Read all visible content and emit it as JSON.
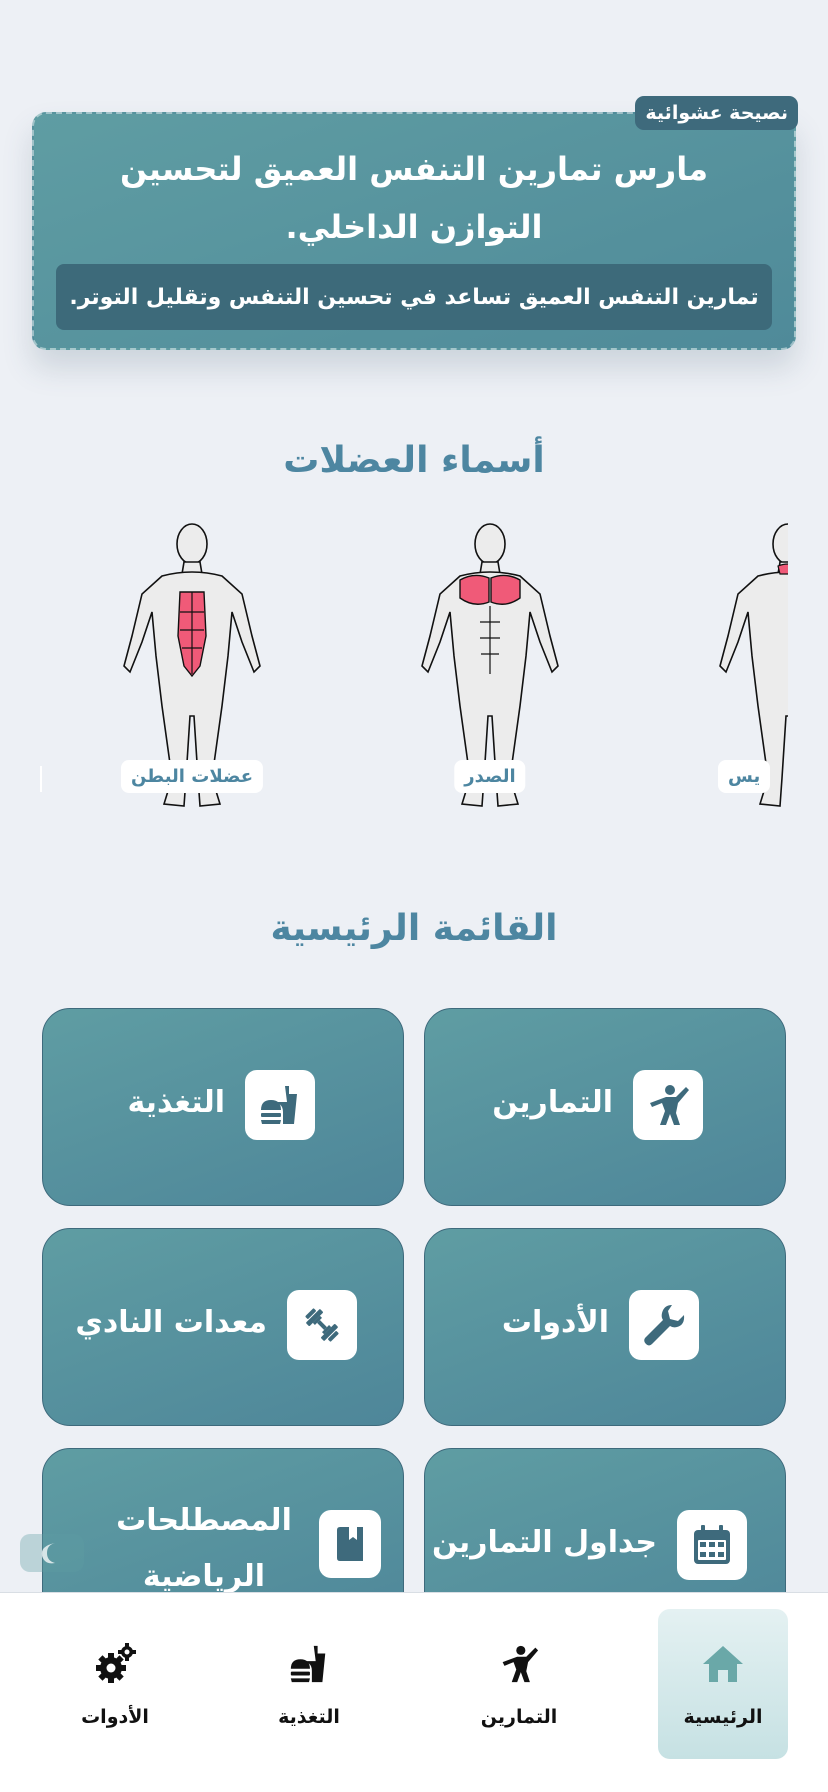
{
  "tip": {
    "badge": "نصيحة عشوائية",
    "title": "مارس تمارين التنفس العميق لتحسين التوازن الداخلي.",
    "body": "تمارين التنفس العميق تساعد في تحسين التنفس وتقليل التوتر."
  },
  "muscles_section": {
    "title": "أسماء العضلات",
    "items": [
      {
        "label": "عضلات البطن",
        "highlight": "abs"
      },
      {
        "label": "الصدر",
        "highlight": "chest"
      },
      {
        "label": "يس",
        "highlight": "shoulders"
      }
    ]
  },
  "main_menu": {
    "title": "القائمة الرئيسية",
    "items": [
      {
        "label": "التمارين",
        "icon": "martial-arts-icon"
      },
      {
        "label": "التغذية",
        "icon": "food-icon"
      },
      {
        "label": "الأدوات",
        "icon": "wrench-icon"
      },
      {
        "label": "معدات النادي",
        "icon": "dumbbell-icon"
      },
      {
        "label": "جداول التمارين",
        "icon": "calendar-icon"
      },
      {
        "label": "المصطلحات الرياضية",
        "icon": "book-icon"
      }
    ]
  },
  "theme_toggle": {
    "icon": "moon-icon"
  },
  "bottom_nav": {
    "items": [
      {
        "label": "الرئيسية",
        "icon": "home-icon",
        "active": true
      },
      {
        "label": "التمارين",
        "icon": "martial-arts-icon",
        "active": false
      },
      {
        "label": "التغذية",
        "icon": "food-icon",
        "active": false
      },
      {
        "label": "الأدوات",
        "icon": "gears-icon",
        "active": false
      }
    ]
  },
  "colors": {
    "background": "#edf0f5",
    "accent": "#4d86a1",
    "card_gradient_start": "#5f9da3",
    "card_gradient_end": "#4e8699",
    "dark_teal": "#3e6a7c",
    "muscle_highlight": "#f05a78"
  }
}
